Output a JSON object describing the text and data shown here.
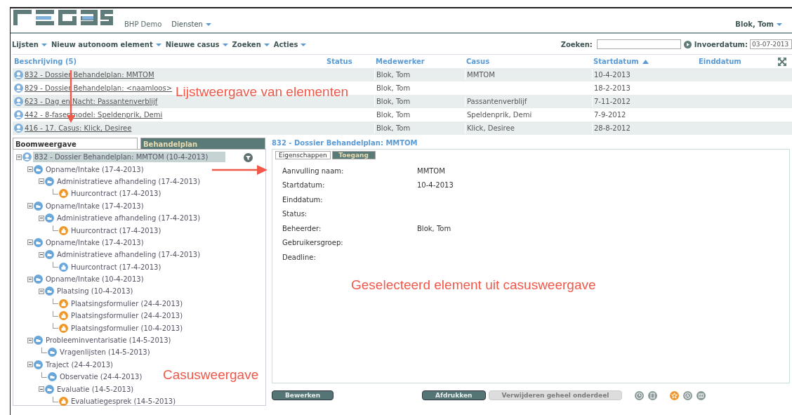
{
  "header": {
    "org": "BHP Demo",
    "menu": "Diensten",
    "user": "Blok, Tom"
  },
  "toolbar": {
    "menus": [
      "Lijsten",
      "Nieuw autonoom element",
      "Nieuwe casus",
      "Zoeken",
      "Acties"
    ],
    "search_label": "Zoeken:",
    "date_label": "Invoerdatum:",
    "date_value": "03-07-2013"
  },
  "table": {
    "columns": [
      {
        "label": "Beschrijving (5)",
        "sorted": false
      },
      {
        "label": "Status",
        "sorted": false
      },
      {
        "label": "Medewerker",
        "sorted": false
      },
      {
        "label": "Casus",
        "sorted": false
      },
      {
        "label": "Startdatum",
        "sorted": true
      },
      {
        "label": "Einddatum",
        "sorted": false
      }
    ],
    "rows": [
      {
        "description": "832 - Dossier Behandelplan: MMTOM",
        "employee": "Blok, Tom",
        "case": "MMTOM",
        "start": "10-4-2013"
      },
      {
        "description": "829 - Dossier Behandelplan: <naamloos>",
        "employee": "Blok, Tom",
        "start": "18-2-2013"
      },
      {
        "description": "623 - Dag en Nacht: Passantenverblijf",
        "employee": "Blok, Tom",
        "case": "Passantenverblijf",
        "start": "7-11-2012"
      },
      {
        "description": "442 - 8-fasenmodel: Speldenprik, Demi",
        "employee": "Blok, Tom",
        "case": "Speldenprik, Demi",
        "start": "7-9-2012"
      },
      {
        "description": "416 - 17. Casus: Klick, Desiree",
        "employee": "Blok, Tom",
        "case": "Klick, Desiree",
        "start": "28-8-2012"
      }
    ]
  },
  "left_tabs": [
    {
      "label": "Boomweergave",
      "selected": true
    },
    {
      "label": "Behandelplan",
      "selected": false
    }
  ],
  "tree": [
    {
      "label": "832 - Dossier Behandelplan: MMTOM (10-4-2013)",
      "kind": "dossier",
      "selected": true,
      "children": [
        {
          "label": "Opname/Intake (17-4-2013)",
          "kind": "folder",
          "selected": false,
          "children": [
            {
              "label": "Administratieve afhandeling (17-4-2013)",
              "kind": "folder",
              "selected": false,
              "children": [
                {
                  "label": "Huurcontract (17-4-2013)",
                  "kind": "form",
                  "color": "#f0962a",
                  "selected": false
                }
              ]
            }
          ]
        },
        {
          "label": "Opname/Intake (17-4-2013)",
          "kind": "folder",
          "selected": false,
          "children": [
            {
              "label": "Administratieve afhandeling (17-4-2013)",
              "kind": "folder",
              "selected": false,
              "children": [
                {
                  "label": "Huurcontract (17-4-2013)",
                  "kind": "form",
                  "color": "#f0962a",
                  "selected": false
                }
              ]
            }
          ]
        },
        {
          "label": "Opname/Intake (17-4-2013)",
          "kind": "folder",
          "selected": false,
          "children": [
            {
              "label": "Administratieve afhandeling (17-4-2013)",
              "kind": "folder",
              "selected": false,
              "children": [
                {
                  "label": "Huurcontract (17-4-2013)",
                  "kind": "form",
                  "color": "#6aa8dc",
                  "selected": false
                }
              ]
            }
          ]
        },
        {
          "label": "Opname/Intake (10-4-2013)",
          "kind": "folder",
          "selected": false,
          "children": [
            {
              "label": "Plaatsing (10-4-2013)",
              "kind": "folder",
              "selected": false,
              "children": [
                {
                  "label": "Plaatsingsformulier (24-4-2013)",
                  "kind": "form",
                  "color": "#f0962a",
                  "selected": false
                },
                {
                  "label": "Plaatsingsformulier (24-4-2013)",
                  "kind": "form",
                  "color": "#f0962a",
                  "selected": false
                },
                {
                  "label": "Plaatsingsformulier (10-4-2013)",
                  "kind": "form",
                  "color": "#f0962a",
                  "selected": false
                }
              ]
            }
          ]
        },
        {
          "label": "Probleeminventarisatie (14-5-2013)",
          "kind": "folder",
          "selected": false,
          "children": [
            {
              "label": "Vragenlijsten (14-5-2013)",
              "kind": "folder",
              "selected": false
            }
          ]
        },
        {
          "label": "Traject (24-4-2013)",
          "kind": "folder",
          "selected": false,
          "children": [
            {
              "label": "Observatie (24-4-2013)",
              "kind": "folder",
              "selected": false
            },
            {
              "label": "Evaluatie (14-5-2013)",
              "kind": "folder",
              "selected": false,
              "children": [
                {
                  "label": "Evaluatiegesprek (14-5-2013)",
                  "kind": "form",
                  "color": "#f0962a",
                  "selected": false
                }
              ]
            }
          ]
        }
      ]
    }
  ],
  "detail": {
    "title": "832 - Dossier Behandelplan: MMTOM",
    "tabs": [
      {
        "label": "Eigenschappen",
        "selected": true
      },
      {
        "label": "Toegang",
        "selected": false
      }
    ],
    "properties": [
      {
        "label": "Aanvulling naam:",
        "value": "MMTOM"
      },
      {
        "label": "Startdatum:",
        "value": "10-4-2013"
      },
      {
        "label": "Einddatum:"
      },
      {
        "label": "Status:"
      },
      {
        "label": "Beheerder:",
        "value": "Blok, Tom"
      },
      {
        "label": "Gebruikersgroep:"
      },
      {
        "label": "Deadline:"
      }
    ],
    "buttons": [
      {
        "label": "Bewerken",
        "disabled": false
      },
      {
        "label": "Afdrukken",
        "disabled": false
      },
      {
        "label": "Verwijderen geheel onderdeel",
        "disabled": true
      }
    ]
  },
  "annotations": [
    "Lijstweergave van elementen",
    "Geselecteerd element uit casusweergave",
    "Casusweergave"
  ]
}
